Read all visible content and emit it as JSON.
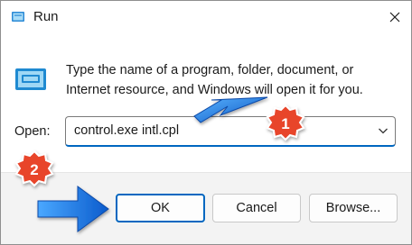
{
  "window": {
    "title": "Run",
    "app_icon": "run-icon",
    "close_icon": "close-icon"
  },
  "body": {
    "description_line1": "Type the name of a program, folder, document, or",
    "description_line2": "Internet resource, and Windows will open it for you.",
    "open_label": "Open:",
    "open_value": "control.exe intl.cpl",
    "dropdown_icon": "chevron-down-icon"
  },
  "buttons": {
    "ok": "OK",
    "cancel": "Cancel",
    "browse": "Browse..."
  },
  "annotations": {
    "badge1": "1",
    "badge2": "2"
  },
  "colors": {
    "accent": "#0067c0",
    "badge": "#e8452c",
    "arrow": "#1a73d9"
  }
}
